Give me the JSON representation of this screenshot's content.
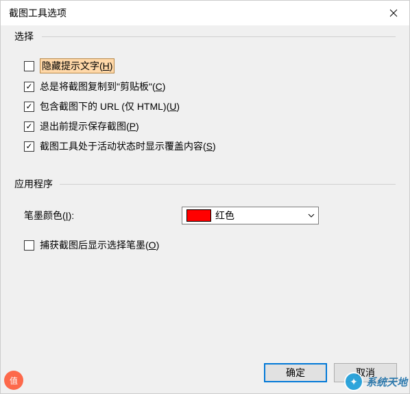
{
  "titlebar": {
    "title": "截图工具选项"
  },
  "groups": {
    "select": {
      "label": "选择",
      "options": [
        {
          "label": "隐藏提示文字(",
          "accel": "H",
          "suffix": ")",
          "checked": false,
          "highlight": true
        },
        {
          "label": "总是将截图复制到\"剪贴板\"(",
          "accel": "C",
          "suffix": ")",
          "checked": true
        },
        {
          "label": "包含截图下的 URL (仅 HTML)(",
          "accel": "U",
          "suffix": ")",
          "checked": true
        },
        {
          "label": "退出前提示保存截图(",
          "accel": "P",
          "suffix": ")",
          "checked": true
        },
        {
          "label": "截图工具处于活动状态时显示覆盖内容(",
          "accel": "S",
          "suffix": ")",
          "checked": true
        }
      ]
    },
    "app": {
      "label": "应用程序",
      "ink_label_pre": "笔墨颜色(",
      "ink_accel": "I",
      "ink_label_post": "):",
      "ink_color": "#ff0000",
      "ink_color_name": "红色",
      "show_pen": {
        "label": "捕获截图后显示选择笔墨(",
        "accel": "O",
        "suffix": ")",
        "checked": false
      }
    }
  },
  "buttons": {
    "ok": "确定",
    "cancel": "取消"
  },
  "watermark": {
    "left": "值",
    "right": "系统天地"
  }
}
